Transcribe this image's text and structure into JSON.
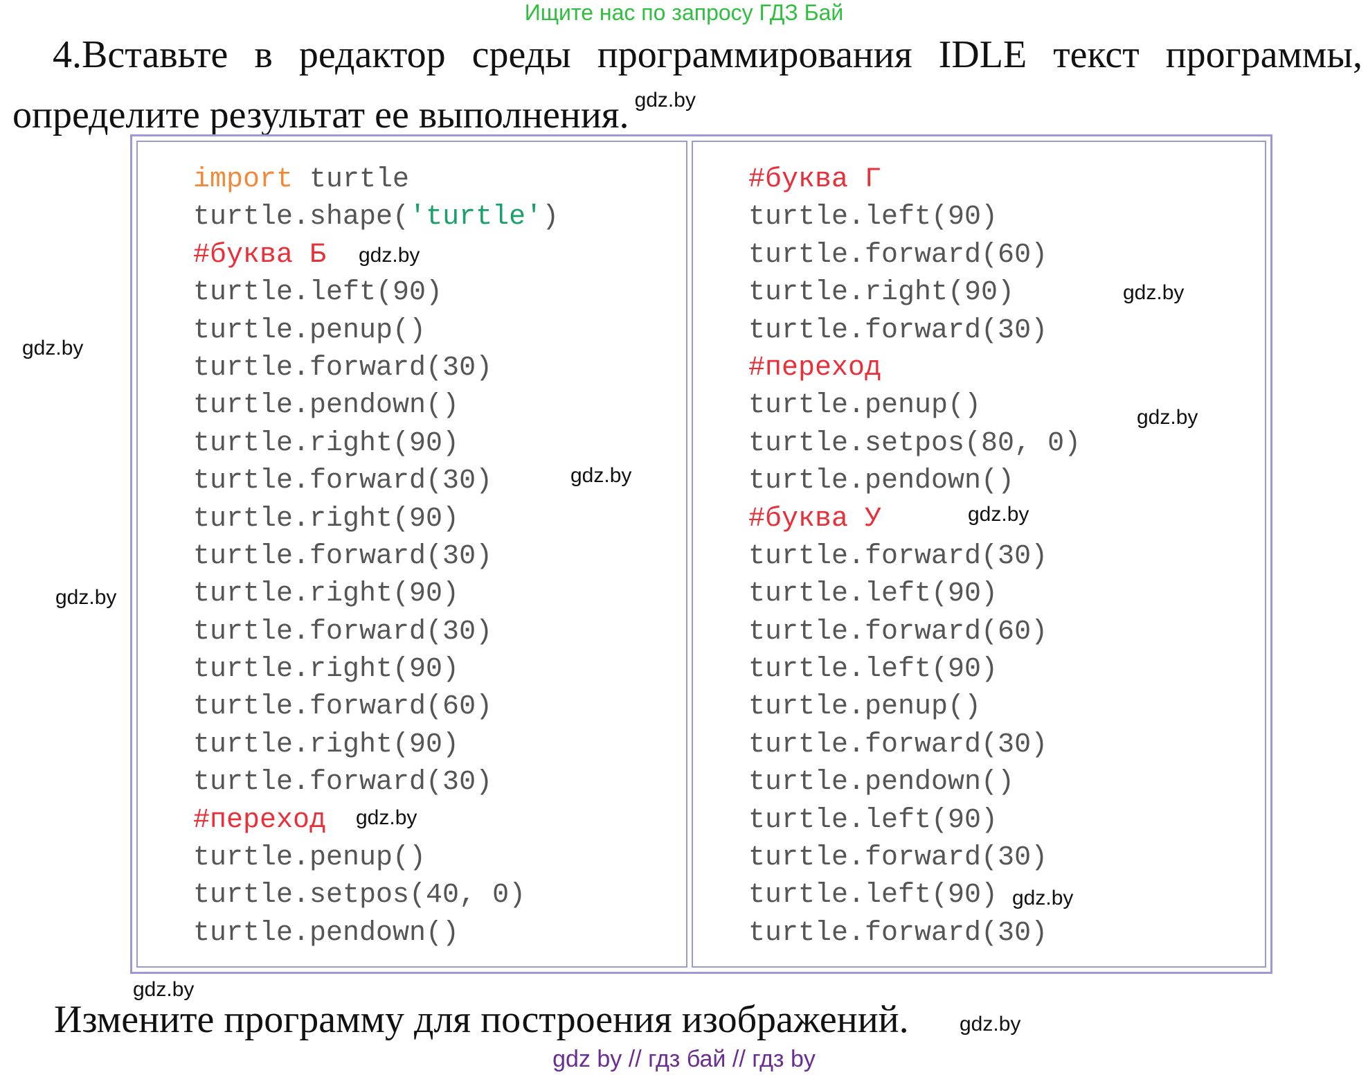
{
  "banner": "Ищите нас по запросу ГДЗ Бай",
  "task": {
    "line1": "4.Вставьте в редактор среды программирования IDLE текст программы,",
    "line2": "определите результат ее выполнения.",
    "inline_watermark": "gdz.by"
  },
  "code_left": [
    [
      {
        "t": "import",
        "c": "kw"
      },
      {
        "t": " turtle",
        "c": ""
      }
    ],
    [
      {
        "t": "turtle.shape(",
        "c": ""
      },
      {
        "t": "'turtle'",
        "c": "str"
      },
      {
        "t": ")",
        "c": ""
      }
    ],
    [
      {
        "t": "#буква Б",
        "c": "cmt"
      }
    ],
    [
      {
        "t": "turtle.left(90)",
        "c": ""
      }
    ],
    [
      {
        "t": "turtle.penup()",
        "c": ""
      }
    ],
    [
      {
        "t": "turtle.forward(30)",
        "c": ""
      }
    ],
    [
      {
        "t": "turtle.pendown()",
        "c": ""
      }
    ],
    [
      {
        "t": "turtle.right(90)",
        "c": ""
      }
    ],
    [
      {
        "t": "turtle.forward(30)",
        "c": ""
      }
    ],
    [
      {
        "t": "turtle.right(90)",
        "c": ""
      }
    ],
    [
      {
        "t": "turtle.forward(30)",
        "c": ""
      }
    ],
    [
      {
        "t": "turtle.right(90)",
        "c": ""
      }
    ],
    [
      {
        "t": "turtle.forward(30)",
        "c": ""
      }
    ],
    [
      {
        "t": "turtle.right(90)",
        "c": ""
      }
    ],
    [
      {
        "t": "turtle.forward(60)",
        "c": ""
      }
    ],
    [
      {
        "t": "turtle.right(90)",
        "c": ""
      }
    ],
    [
      {
        "t": "turtle.forward(30)",
        "c": ""
      }
    ],
    [
      {
        "t": "#переход",
        "c": "cmt"
      }
    ],
    [
      {
        "t": "turtle.penup()",
        "c": ""
      }
    ],
    [
      {
        "t": "turtle.setpos(40, 0)",
        "c": ""
      }
    ],
    [
      {
        "t": "turtle.pendown()",
        "c": ""
      }
    ]
  ],
  "code_right": [
    [
      {
        "t": "#буква Г",
        "c": "cmt"
      }
    ],
    [
      {
        "t": "turtle.left(90)",
        "c": ""
      }
    ],
    [
      {
        "t": "turtle.forward(60)",
        "c": ""
      }
    ],
    [
      {
        "t": "turtle.right(90)",
        "c": ""
      }
    ],
    [
      {
        "t": "turtle.forward(30)",
        "c": ""
      }
    ],
    [
      {
        "t": "#переход",
        "c": "cmt"
      }
    ],
    [
      {
        "t": "turtle.penup()",
        "c": ""
      }
    ],
    [
      {
        "t": "turtle.setpos(80, 0)",
        "c": ""
      }
    ],
    [
      {
        "t": "turtle.pendown()",
        "c": ""
      }
    ],
    [
      {
        "t": "#буква У",
        "c": "cmt"
      }
    ],
    [
      {
        "t": "turtle.forward(30)",
        "c": ""
      }
    ],
    [
      {
        "t": "turtle.left(90)",
        "c": ""
      }
    ],
    [
      {
        "t": "turtle.forward(60)",
        "c": ""
      }
    ],
    [
      {
        "t": "turtle.left(90)",
        "c": ""
      }
    ],
    [
      {
        "t": "turtle.penup()",
        "c": ""
      }
    ],
    [
      {
        "t": "turtle.forward(30)",
        "c": ""
      }
    ],
    [
      {
        "t": "turtle.pendown()",
        "c": ""
      }
    ],
    [
      {
        "t": "turtle.left(90)",
        "c": ""
      }
    ],
    [
      {
        "t": "turtle.forward(30)",
        "c": ""
      }
    ],
    [
      {
        "t": "turtle.left(90)",
        "c": ""
      }
    ],
    [
      {
        "t": "turtle.forward(30)",
        "c": ""
      }
    ]
  ],
  "watermarks": {
    "wm1": "gdz.by",
    "wm2": "gdz.by",
    "wm3": "gdz.by",
    "wm4": "gdz.by",
    "wm5": "gdz.by",
    "wm6": "gdz.by",
    "wm7": "gdz.by",
    "wm8": "gdz.by",
    "wm9": "gdz.by",
    "wm10": "gdz.by",
    "wm11": "gdz.by",
    "wm12": "gdz.by"
  },
  "bottom_text": "Измените программу для построения изображений.",
  "footer": "gdz by  //  гдз бай  //  гдз by",
  "colors": {
    "keyword": "#f08a3a",
    "string": "#1aa06a",
    "comment": "#e8303a",
    "code": "#555555",
    "frame": "#9a9ad6",
    "banner": "#2fbf3f",
    "footer": "#6b2d8f"
  }
}
